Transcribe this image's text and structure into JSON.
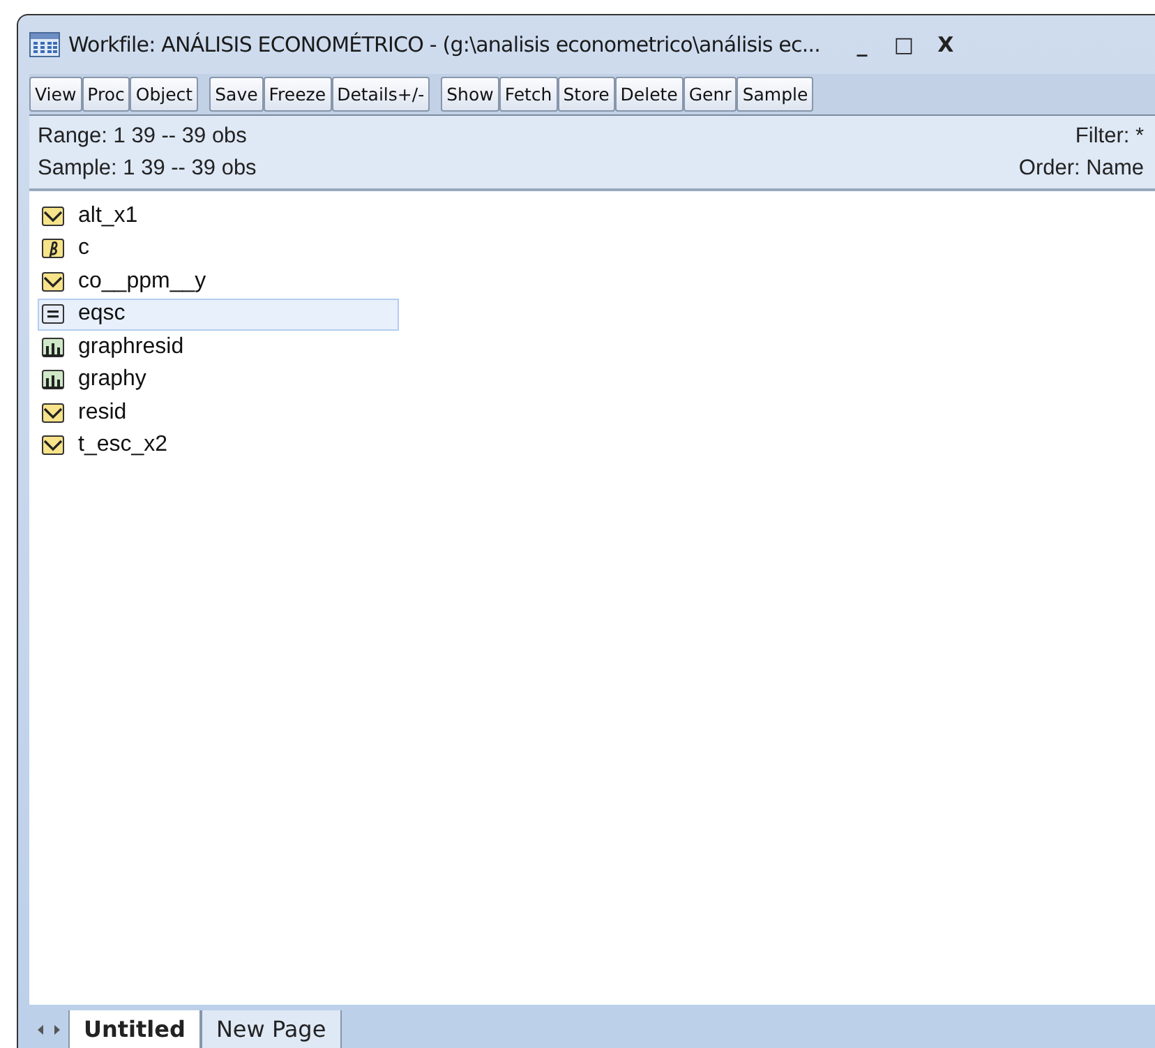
{
  "window": {
    "title": "Workfile: ANÁLISIS ECONOMÉTRICO - (g:\\analisis econometrico\\análisis ec...",
    "controls": [
      "_",
      "□",
      "X"
    ]
  },
  "toolbar_groups": [
    [
      "View",
      "Proc",
      "Object"
    ],
    [
      "Save",
      "Freeze",
      "Details+/-"
    ],
    [
      "Show",
      "Fetch",
      "Store",
      "Delete",
      "Genr",
      "Sample"
    ]
  ],
  "info": {
    "range": "Range:  1 39  --  39 obs",
    "sample": "Sample: 1 39  --  39 obs",
    "filter": "Filter: *",
    "order": "Order: Name"
  },
  "objects": [
    {
      "name": "alt_x1",
      "kind": "series",
      "selected": false
    },
    {
      "name": "c",
      "kind": "coef",
      "selected": false
    },
    {
      "name": "co__ppm__y",
      "kind": "series",
      "selected": false
    },
    {
      "name": "eqsc",
      "kind": "equation",
      "selected": true
    },
    {
      "name": "graphresid",
      "kind": "graph",
      "selected": false
    },
    {
      "name": "graphy",
      "kind": "graph",
      "selected": false
    },
    {
      "name": "resid",
      "kind": "series",
      "selected": false
    },
    {
      "name": "t_esc_x2",
      "kind": "series",
      "selected": false
    }
  ],
  "page_tabs": [
    {
      "label": "Untitled",
      "selected": true
    },
    {
      "label": "New Page",
      "selected": false
    }
  ]
}
